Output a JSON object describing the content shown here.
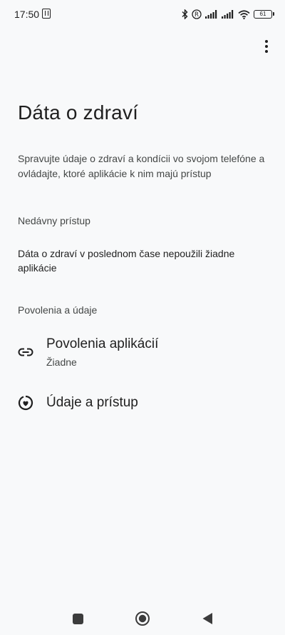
{
  "status_bar": {
    "time": "17:50",
    "battery_level": "61"
  },
  "header": {
    "title": "Dáta o zdraví",
    "description": "Spravujte údaje o zdraví a kondícii vo svojom telefóne a ovládajte, ktoré aplikácie k nim majú prístup"
  },
  "recent_access": {
    "header": "Nedávny prístup",
    "text": "Dáta o zdraví v poslednom čase nepoužili žiadne aplikácie"
  },
  "permissions_section": {
    "header": "Povolenia a údaje",
    "items": [
      {
        "title": "Povolenia aplikácií",
        "subtitle": "Žiadne",
        "icon": "link-icon"
      },
      {
        "title": "Údaje a prístup",
        "icon": "health-data-icon"
      }
    ]
  },
  "nav_bar": {
    "icons": [
      "recents-square-icon",
      "home-circle-icon",
      "back-triangle-icon"
    ]
  },
  "colors": {
    "background": "#f8f9fa",
    "text_primary": "#1f1f1f",
    "text_secondary": "#444746"
  }
}
